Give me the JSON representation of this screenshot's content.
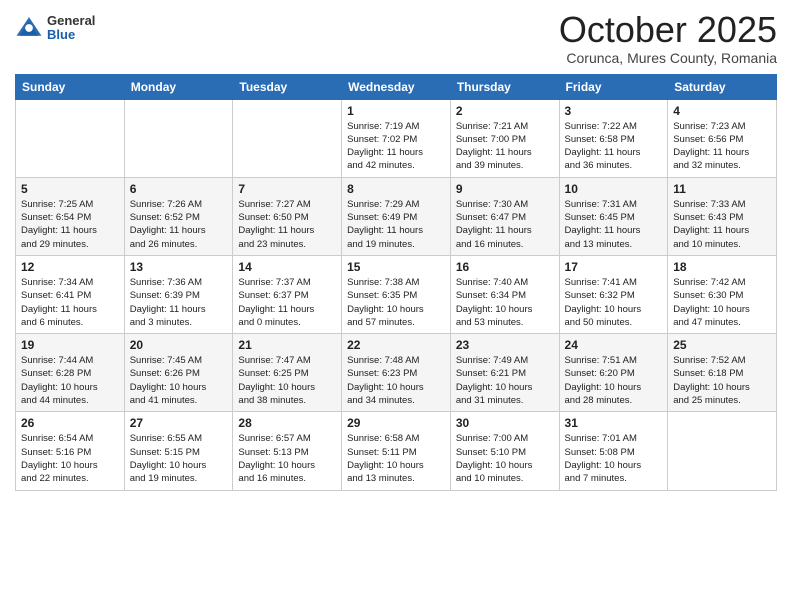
{
  "header": {
    "logo_general": "General",
    "logo_blue": "Blue",
    "month_title": "October 2025",
    "subtitle": "Corunca, Mures County, Romania"
  },
  "weekdays": [
    "Sunday",
    "Monday",
    "Tuesday",
    "Wednesday",
    "Thursday",
    "Friday",
    "Saturday"
  ],
  "weeks": [
    [
      {
        "day": "",
        "info": ""
      },
      {
        "day": "",
        "info": ""
      },
      {
        "day": "",
        "info": ""
      },
      {
        "day": "1",
        "info": "Sunrise: 7:19 AM\nSunset: 7:02 PM\nDaylight: 11 hours\nand 42 minutes."
      },
      {
        "day": "2",
        "info": "Sunrise: 7:21 AM\nSunset: 7:00 PM\nDaylight: 11 hours\nand 39 minutes."
      },
      {
        "day": "3",
        "info": "Sunrise: 7:22 AM\nSunset: 6:58 PM\nDaylight: 11 hours\nand 36 minutes."
      },
      {
        "day": "4",
        "info": "Sunrise: 7:23 AM\nSunset: 6:56 PM\nDaylight: 11 hours\nand 32 minutes."
      }
    ],
    [
      {
        "day": "5",
        "info": "Sunrise: 7:25 AM\nSunset: 6:54 PM\nDaylight: 11 hours\nand 29 minutes."
      },
      {
        "day": "6",
        "info": "Sunrise: 7:26 AM\nSunset: 6:52 PM\nDaylight: 11 hours\nand 26 minutes."
      },
      {
        "day": "7",
        "info": "Sunrise: 7:27 AM\nSunset: 6:50 PM\nDaylight: 11 hours\nand 23 minutes."
      },
      {
        "day": "8",
        "info": "Sunrise: 7:29 AM\nSunset: 6:49 PM\nDaylight: 11 hours\nand 19 minutes."
      },
      {
        "day": "9",
        "info": "Sunrise: 7:30 AM\nSunset: 6:47 PM\nDaylight: 11 hours\nand 16 minutes."
      },
      {
        "day": "10",
        "info": "Sunrise: 7:31 AM\nSunset: 6:45 PM\nDaylight: 11 hours\nand 13 minutes."
      },
      {
        "day": "11",
        "info": "Sunrise: 7:33 AM\nSunset: 6:43 PM\nDaylight: 11 hours\nand 10 minutes."
      }
    ],
    [
      {
        "day": "12",
        "info": "Sunrise: 7:34 AM\nSunset: 6:41 PM\nDaylight: 11 hours\nand 6 minutes."
      },
      {
        "day": "13",
        "info": "Sunrise: 7:36 AM\nSunset: 6:39 PM\nDaylight: 11 hours\nand 3 minutes."
      },
      {
        "day": "14",
        "info": "Sunrise: 7:37 AM\nSunset: 6:37 PM\nDaylight: 11 hours\nand 0 minutes."
      },
      {
        "day": "15",
        "info": "Sunrise: 7:38 AM\nSunset: 6:35 PM\nDaylight: 10 hours\nand 57 minutes."
      },
      {
        "day": "16",
        "info": "Sunrise: 7:40 AM\nSunset: 6:34 PM\nDaylight: 10 hours\nand 53 minutes."
      },
      {
        "day": "17",
        "info": "Sunrise: 7:41 AM\nSunset: 6:32 PM\nDaylight: 10 hours\nand 50 minutes."
      },
      {
        "day": "18",
        "info": "Sunrise: 7:42 AM\nSunset: 6:30 PM\nDaylight: 10 hours\nand 47 minutes."
      }
    ],
    [
      {
        "day": "19",
        "info": "Sunrise: 7:44 AM\nSunset: 6:28 PM\nDaylight: 10 hours\nand 44 minutes."
      },
      {
        "day": "20",
        "info": "Sunrise: 7:45 AM\nSunset: 6:26 PM\nDaylight: 10 hours\nand 41 minutes."
      },
      {
        "day": "21",
        "info": "Sunrise: 7:47 AM\nSunset: 6:25 PM\nDaylight: 10 hours\nand 38 minutes."
      },
      {
        "day": "22",
        "info": "Sunrise: 7:48 AM\nSunset: 6:23 PM\nDaylight: 10 hours\nand 34 minutes."
      },
      {
        "day": "23",
        "info": "Sunrise: 7:49 AM\nSunset: 6:21 PM\nDaylight: 10 hours\nand 31 minutes."
      },
      {
        "day": "24",
        "info": "Sunrise: 7:51 AM\nSunset: 6:20 PM\nDaylight: 10 hours\nand 28 minutes."
      },
      {
        "day": "25",
        "info": "Sunrise: 7:52 AM\nSunset: 6:18 PM\nDaylight: 10 hours\nand 25 minutes."
      }
    ],
    [
      {
        "day": "26",
        "info": "Sunrise: 6:54 AM\nSunset: 5:16 PM\nDaylight: 10 hours\nand 22 minutes."
      },
      {
        "day": "27",
        "info": "Sunrise: 6:55 AM\nSunset: 5:15 PM\nDaylight: 10 hours\nand 19 minutes."
      },
      {
        "day": "28",
        "info": "Sunrise: 6:57 AM\nSunset: 5:13 PM\nDaylight: 10 hours\nand 16 minutes."
      },
      {
        "day": "29",
        "info": "Sunrise: 6:58 AM\nSunset: 5:11 PM\nDaylight: 10 hours\nand 13 minutes."
      },
      {
        "day": "30",
        "info": "Sunrise: 7:00 AM\nSunset: 5:10 PM\nDaylight: 10 hours\nand 10 minutes."
      },
      {
        "day": "31",
        "info": "Sunrise: 7:01 AM\nSunset: 5:08 PM\nDaylight: 10 hours\nand 7 minutes."
      },
      {
        "day": "",
        "info": ""
      }
    ]
  ]
}
